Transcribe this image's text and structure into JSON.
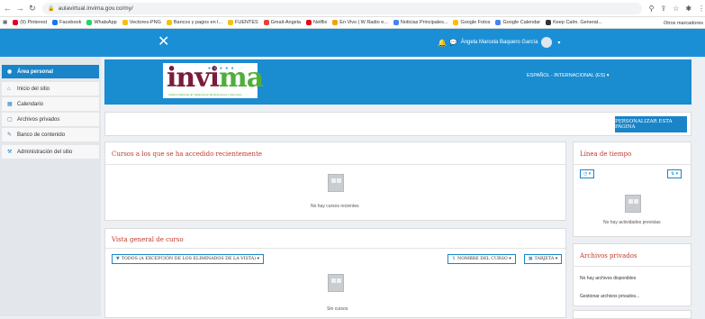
{
  "browser": {
    "url": "aulavirtual.invima.gov.co/my/",
    "bookmarks": [
      "(9) Pinterest",
      "Facebook",
      "WhatsApp",
      "Vectores-PNG",
      "Bancos y pagos en l...",
      "FUENTES",
      "Gmail-Angela",
      "Netflix",
      "En Vivo | W Radio e...",
      "Noticias Principales...",
      "Google Fotos",
      "Google Calendar",
      "Keep Calm. Generat..."
    ],
    "bookmarks_right": "Otros marcadores"
  },
  "navbar": {
    "close_glyph": "✕",
    "user_name": "Ángela Marcela Baquero García",
    "user_caret": "▾"
  },
  "sidebar": {
    "items": [
      {
        "label": "Área personal",
        "icon": "dashboard-icon",
        "glyph": "◉",
        "active": true
      },
      {
        "label": "Inicio del sitio",
        "icon": "home-icon",
        "glyph": "⌂",
        "active": false
      },
      {
        "label": "Calendario",
        "icon": "calendar-icon",
        "glyph": "▦",
        "active": false
      },
      {
        "label": "Archivos privados",
        "icon": "file-icon",
        "glyph": "▢",
        "active": false
      },
      {
        "label": "Banco de contenido",
        "icon": "pencil-icon",
        "glyph": "✎",
        "active": false
      },
      {
        "label": "Administración del sitio",
        "icon": "wrench-icon",
        "glyph": "⚒",
        "active": false
      }
    ]
  },
  "header": {
    "logo_word_a": "invi",
    "logo_word_b": "ma",
    "logo_tagline": "Instituto Nacional de Vigilancia de Medicamentos y Alimentos",
    "language": "ESPAÑOL - INTERNACIONAL (ES) ▾"
  },
  "customise_label": "PERSONALIZAR ESTA PÁGINA",
  "recent": {
    "title": "Cursos a los que se ha accedido recientemente",
    "empty": "No hay cursos recientes"
  },
  "overview": {
    "title": "Vista general de curso",
    "filter": "TODOS (A EXCEPCIÓN DE LOS ELIMINADOS DE LA VISTA) ▾",
    "sort": "NOMBRE DEL CURSO ▾",
    "view": "TARJETA ▾",
    "empty": "Sin cursos"
  },
  "timeline": {
    "title": "Línea de tiempo",
    "filter_glyph": "◷ ▾",
    "sort_glyph": "⇅ ▾",
    "empty": "No hay actividades previstas"
  },
  "private_files": {
    "title": "Archivos privados",
    "empty": "No hay archivos disponibles",
    "manage": "Gestionar archivos privados..."
  },
  "colors": {
    "navbar": "#1b8fd6",
    "accent": "#1a84c8",
    "block_title": "#c0392b",
    "logo_red": "#7a1d3a",
    "logo_green": "#4fae3a"
  }
}
